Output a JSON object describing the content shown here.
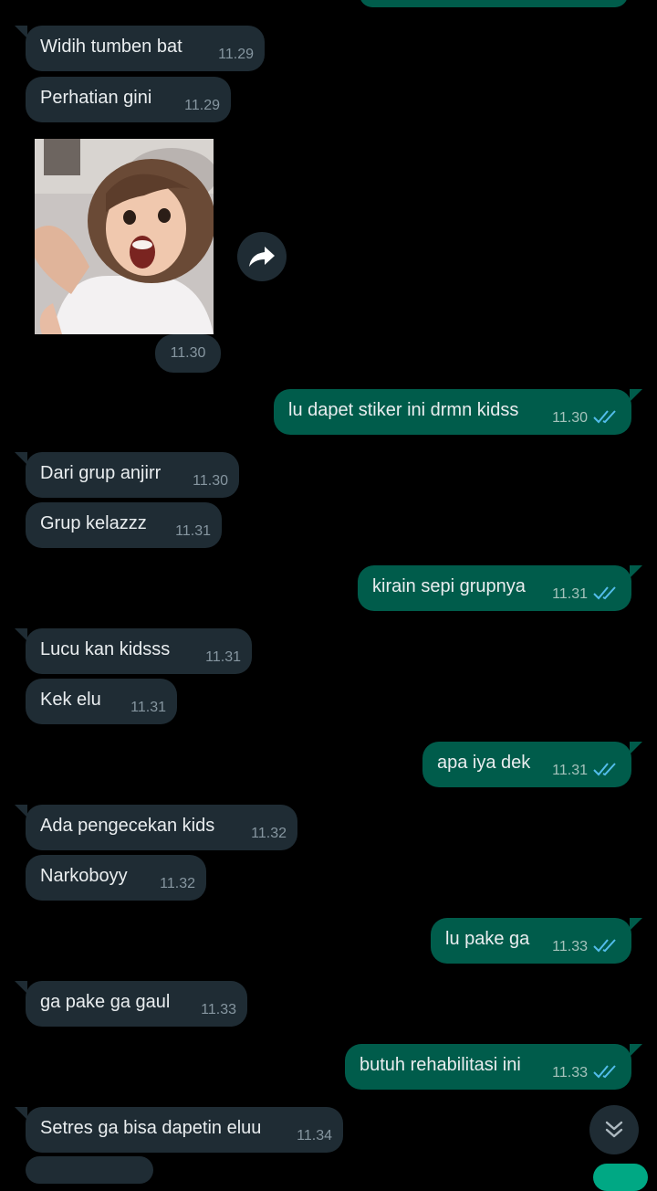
{
  "messages": [
    {
      "dir": "in",
      "text": "Widih tumben bat",
      "time": "11.29"
    },
    {
      "dir": "in",
      "text": "Perhatian gini",
      "time": "11.29"
    },
    {
      "dir": "in",
      "sticker": true,
      "time": "11.30"
    },
    {
      "dir": "out",
      "text": "lu dapet stiker ini drmn kidss",
      "time": "11.30",
      "status": "read"
    },
    {
      "dir": "in",
      "text": "Dari grup anjirr",
      "time": "11.30"
    },
    {
      "dir": "in",
      "text": "Grup kelazzz",
      "time": "11.31"
    },
    {
      "dir": "out",
      "text": "kirain sepi grupnya",
      "time": "11.31",
      "status": "read"
    },
    {
      "dir": "in",
      "text": "Lucu kan kidsss",
      "time": "11.31"
    },
    {
      "dir": "in",
      "text": "Kek elu",
      "time": "11.31"
    },
    {
      "dir": "out",
      "text": "apa iya dek",
      "time": "11.31",
      "status": "read"
    },
    {
      "dir": "in",
      "text": "Ada pengecekan kids",
      "time": "11.32"
    },
    {
      "dir": "in",
      "text": "Narkoboyy",
      "time": "11.32"
    },
    {
      "dir": "out",
      "text": "lu pake ga",
      "time": "11.33",
      "status": "read"
    },
    {
      "dir": "in",
      "text": "ga pake ga gaul",
      "time": "11.33"
    },
    {
      "dir": "out",
      "text": "butuh rehabilitasi ini",
      "time": "11.33",
      "status": "read"
    },
    {
      "dir": "in",
      "text": "Setres ga bisa dapetin eluu",
      "time": "11.34"
    }
  ],
  "icons": {
    "forward": "forward-arrow-icon",
    "read_receipt": "double-check-icon",
    "scroll_down": "double-chevron-down-icon"
  },
  "colors": {
    "background": "#000000",
    "incoming_bubble": "#1f2c34",
    "outgoing_bubble": "#005c4b",
    "read_tick": "#53bdeb",
    "text": "#e9edef",
    "timestamp": "#8696a0"
  }
}
